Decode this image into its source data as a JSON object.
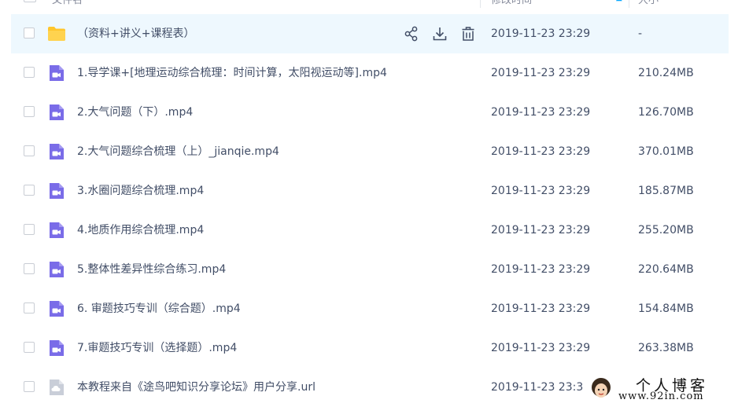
{
  "header": {
    "name_col": "文件名",
    "date_col": "修改时间",
    "size_col": "大小"
  },
  "files": [
    {
      "name": "（资料+讲义+课程表）",
      "date": "2019-11-23 23:29",
      "size": "-",
      "type": "folder",
      "selected": true
    },
    {
      "name": "1.导学课+[地理运动综合梳理：时间计算，太阳视运动等].mp4",
      "date": "2019-11-23 23:29",
      "size": "210.24MB",
      "type": "video"
    },
    {
      "name": "2.大气问题（下）.mp4",
      "date": "2019-11-23 23:29",
      "size": "126.70MB",
      "type": "video"
    },
    {
      "name": "2.大气问题综合梳理（上）_jianqie.mp4",
      "date": "2019-11-23 23:29",
      "size": "370.01MB",
      "type": "video"
    },
    {
      "name": "3.水圈问题综合梳理.mp4",
      "date": "2019-11-23 23:29",
      "size": "185.87MB",
      "type": "video"
    },
    {
      "name": "4.地质作用综合梳理.mp4",
      "date": "2019-11-23 23:29",
      "size": "255.20MB",
      "type": "video"
    },
    {
      "name": "5.整体性差异性综合练习.mp4",
      "date": "2019-11-23 23:29",
      "size": "220.64MB",
      "type": "video"
    },
    {
      "name": "6. 审题技巧专训（综合题）.mp4",
      "date": "2019-11-23 23:29",
      "size": "154.84MB",
      "type": "video"
    },
    {
      "name": "7.审题技巧专训（选择题）.mp4",
      "date": "2019-11-23 23:29",
      "size": "263.38MB",
      "type": "video"
    },
    {
      "name": "本教程来自《途鸟吧知识分享论坛》用户分享.url",
      "date": "2019-11-23 23:3",
      "size": "",
      "type": "link"
    }
  ],
  "row_actions": [
    "share-icon",
    "download-icon",
    "delete-icon"
  ],
  "icons": {
    "folder": "folder-icon",
    "video": "video-file-icon",
    "link": "cloud-link-icon"
  },
  "colors": {
    "selected_row": "#eef8fe",
    "folder": "#ffc62c",
    "video": "#7a6ce8",
    "link": "#c9ced8",
    "accent": "#06a7ff"
  },
  "watermark": {
    "line1": "个人博客",
    "line2": "www.92in.com"
  }
}
